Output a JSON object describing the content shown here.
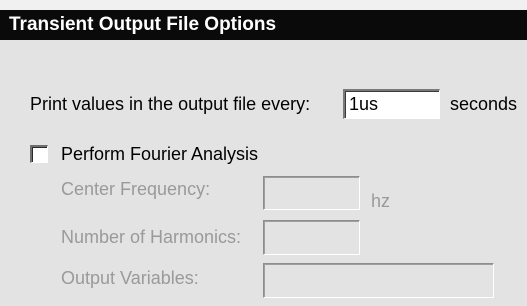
{
  "window": {
    "title": "Transient Output File Options"
  },
  "print_interval": {
    "label": "Print values in the output file every:",
    "value": "1us",
    "unit": "seconds"
  },
  "fourier": {
    "checkbox_label": "Perform Fourier Analysis",
    "checked": false,
    "center_frequency": {
      "label": "Center Frequency:",
      "value": "",
      "unit": "hz"
    },
    "number_of_harmonics": {
      "label": "Number of Harmonics:",
      "value": ""
    },
    "output_variables": {
      "label": "Output Variables:",
      "value": ""
    }
  },
  "colors": {
    "title_bar": "#0a0a0a",
    "title_text": "#ffffff",
    "dialog_background": "#e3e3e3",
    "disabled_text": "#9a9a9a"
  }
}
